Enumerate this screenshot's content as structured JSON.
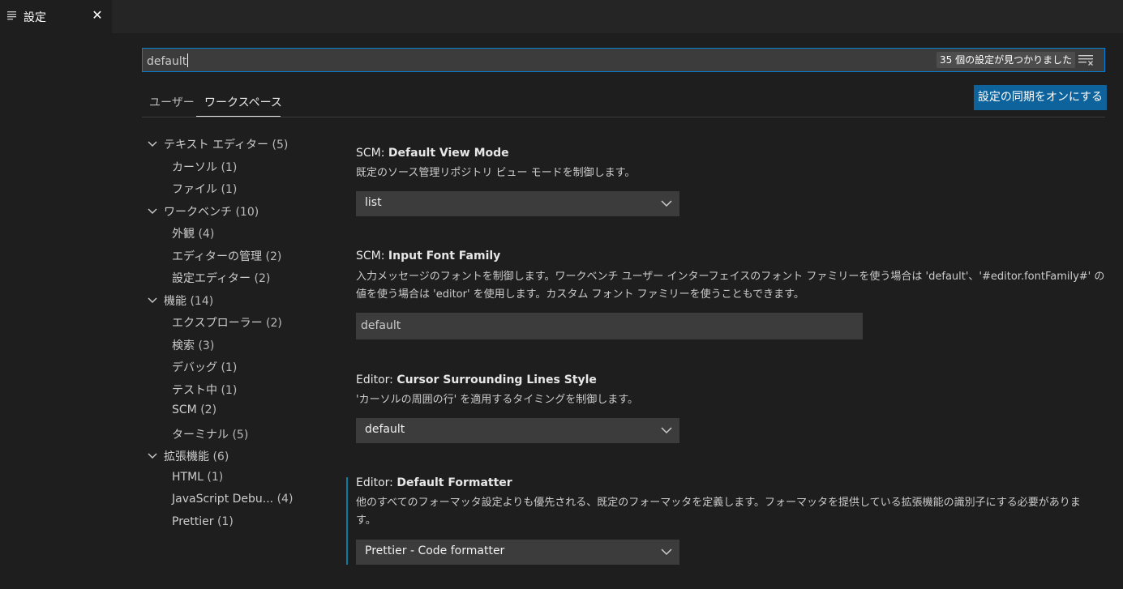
{
  "tab": {
    "title": "設定",
    "icon": "settings-list-icon",
    "close": "✕"
  },
  "search": {
    "value": "default",
    "result_count": "35 個の設定が見つかりました",
    "clear_icon": "clear-filter-icon"
  },
  "scopes": {
    "user": "ユーザー",
    "workspace": "ワークスペース",
    "active": "workspace"
  },
  "sync_button": "設定の同期をオンにする",
  "toc": [
    {
      "label": "テキスト エディター",
      "count": "(5)",
      "level": 0
    },
    {
      "label": "カーソル",
      "count": "(1)",
      "level": 1
    },
    {
      "label": "ファイル",
      "count": "(1)",
      "level": 1
    },
    {
      "label": "ワークベンチ",
      "count": "(10)",
      "level": 0
    },
    {
      "label": "外観",
      "count": "(4)",
      "level": 1
    },
    {
      "label": "エディターの管理",
      "count": "(2)",
      "level": 1
    },
    {
      "label": "設定エディター",
      "count": "(2)",
      "level": 1
    },
    {
      "label": "機能",
      "count": "(14)",
      "level": 0
    },
    {
      "label": "エクスプローラー",
      "count": "(2)",
      "level": 1
    },
    {
      "label": "検索",
      "count": "(3)",
      "level": 1
    },
    {
      "label": "デバッグ",
      "count": "(1)",
      "level": 1
    },
    {
      "label": "テスト中",
      "count": "(1)",
      "level": 1
    },
    {
      "label": "SCM",
      "count": "(2)",
      "level": 1
    },
    {
      "label": "ターミナル",
      "count": "(5)",
      "level": 1
    },
    {
      "label": "拡張機能",
      "count": "(6)",
      "level": 0
    },
    {
      "label": "HTML",
      "count": "(1)",
      "level": 1
    },
    {
      "label": "JavaScript Debu...",
      "count": "(4)",
      "level": 1
    },
    {
      "label": "Prettier",
      "count": "(1)",
      "level": 1
    }
  ],
  "settings": {
    "scm_view_mode": {
      "category": "SCM: ",
      "name": "Default View Mode",
      "description": "既定のソース管理リポジトリ ビュー モードを制御します。",
      "value": "list"
    },
    "scm_input_font": {
      "category": "SCM: ",
      "name": "Input Font Family",
      "description_line1": "入力メッセージのフォントを制御します。ワークベンチ ユーザー インターフェイスのフォント ファミリーを使う場合は 'default'、'#editor.fontFamily#' の",
      "description_line2": "値を使う場合は 'editor' を使用します。カスタム フォント ファミリーを使うこともできます。",
      "value": "default"
    },
    "editor_cursor_style": {
      "category": "Editor: ",
      "name": "Cursor Surrounding Lines Style",
      "description": "'カーソルの周囲の行' を適用するタイミングを制御します。",
      "value": "default"
    },
    "editor_default_formatter": {
      "category": "Editor: ",
      "name": "Default Formatter",
      "description_line1": "他のすべてのフォーマッタ設定よりも優先される、既定のフォーマッタを定義します。フォーマッタを提供している拡張機能の識別子にする必要がありま",
      "description_line2": "す。",
      "value": "Prettier - Code formatter"
    }
  },
  "colors": {
    "accent": "#007fd4",
    "button": "#0e639c",
    "modified": "#0c7d9d"
  }
}
